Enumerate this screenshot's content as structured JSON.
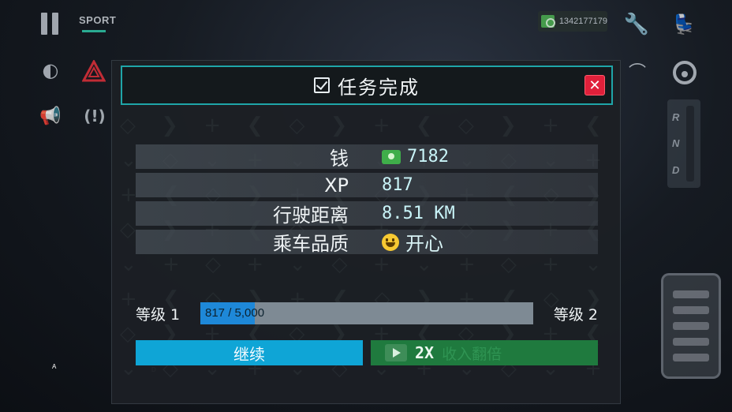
{
  "hud": {
    "mode_label": "SPORT",
    "cash_balance": "1342177179",
    "gear_positions": [
      "R",
      "N",
      "D"
    ],
    "icons": [
      "pause-icon",
      "cash-icon",
      "wrench-icon",
      "seats-icon",
      "headlight-icon",
      "hazard-icon",
      "horn-icon",
      "brake-warning-icon",
      "wiper-icon",
      "steering-icon",
      "gear-lever",
      "pedal"
    ],
    "edge_labels": [
      "A",
      "D"
    ]
  },
  "dialog": {
    "title": "任务完成",
    "close_symbol": "✕",
    "rows": [
      {
        "label": "钱",
        "value": "7182",
        "icon": "money-icon"
      },
      {
        "label": "XP",
        "value": "817"
      },
      {
        "label": "行驶距离",
        "value": "8.51  KM"
      },
      {
        "label": "乘车品质",
        "value": "开心",
        "icon": "smile-icon"
      }
    ],
    "level": {
      "current_label": "等级 1",
      "next_label": "等级 2",
      "progress_text": "817 / 5,000",
      "progress_value": 0.1634
    },
    "buttons": {
      "continue_label": "继续",
      "double_multiplier": "2X",
      "double_label": "收入翻倍"
    }
  },
  "colors": {
    "accent": "#1fa5a8",
    "close": "#e0203a",
    "continue": "#0fa5d6",
    "double": "#1f7a3e",
    "xp_fill": "#1e88d8"
  }
}
